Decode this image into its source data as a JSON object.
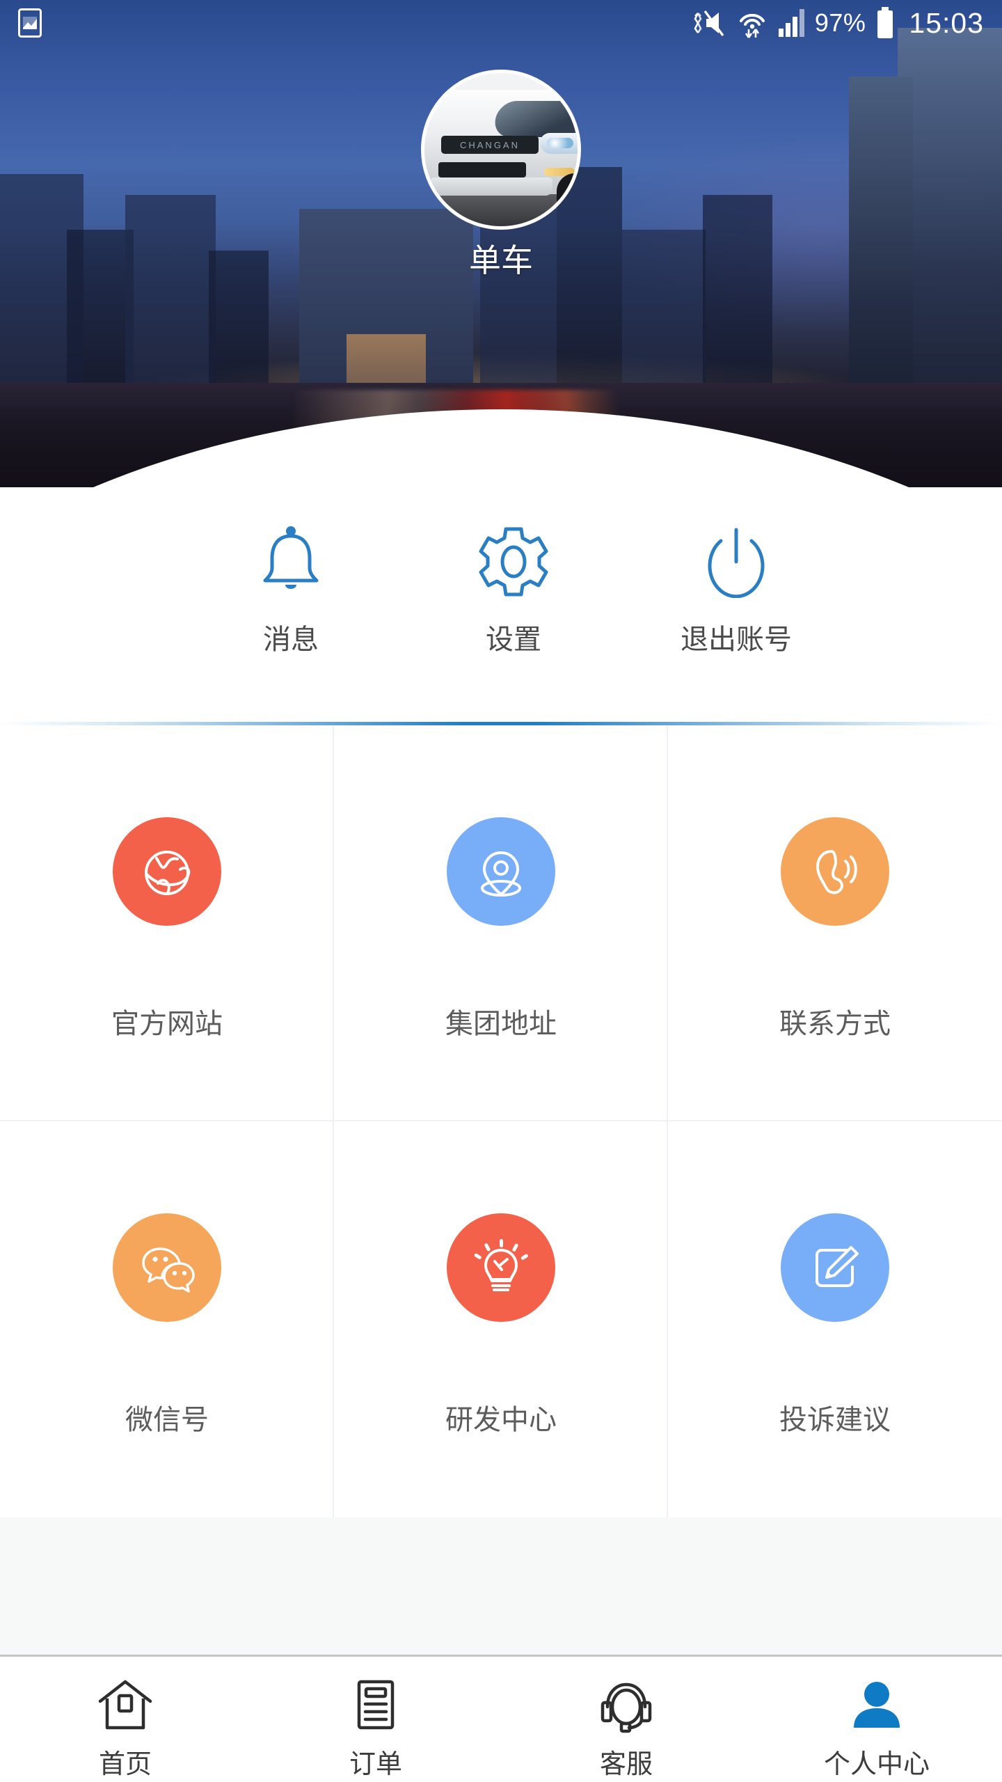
{
  "status_bar": {
    "notification_icon": "screenshot-image-icon",
    "mute_icon": "vibrate-mute-icon",
    "wifi_icon": "wifi-data-transfer-icon",
    "signal_icon": "cellular-signal-icon",
    "battery_percent": "97%",
    "battery_icon": "battery-icon",
    "clock": "15:03"
  },
  "header": {
    "banner_scene": "city-skyline-dusk-photo",
    "avatar_image": "white-suv-car-photo",
    "avatar_brand_text": "CHANGAN",
    "username": "单车"
  },
  "actions": [
    {
      "label": "消息",
      "icon": "bell-icon",
      "color": "#2a7fc4"
    },
    {
      "label": "设置",
      "icon": "gear-icon",
      "color": "#2a7fc4"
    },
    {
      "label": "退出账号",
      "icon": "power-icon",
      "color": "#2a7fc4"
    }
  ],
  "divider": {
    "color": "#1478c8"
  },
  "grid": [
    {
      "label": "官方网站",
      "icon": "globe-icon",
      "color": "#F4614B"
    },
    {
      "label": "集团地址",
      "icon": "location-pin-icon",
      "color": "#78AEF7"
    },
    {
      "label": "联系方式",
      "icon": "phone-call-icon",
      "color": "#F5A65B"
    },
    {
      "label": "微信号",
      "icon": "wechat-icon",
      "color": "#F5A65B"
    },
    {
      "label": "研发中心",
      "icon": "lightbulb-icon",
      "color": "#F4614B"
    },
    {
      "label": "投诉建议",
      "icon": "edit-pencil-icon",
      "color": "#78AEF7"
    }
  ],
  "bottom_nav": {
    "active_color": "#0F7BC4",
    "inactive_color": "#2e2e2e",
    "items": [
      {
        "label": "首页",
        "icon": "home-icon",
        "active": false
      },
      {
        "label": "订单",
        "icon": "order-list-icon",
        "active": false
      },
      {
        "label": "客服",
        "icon": "headset-icon",
        "active": false
      },
      {
        "label": "个人中心",
        "icon": "person-icon",
        "active": true
      }
    ]
  }
}
